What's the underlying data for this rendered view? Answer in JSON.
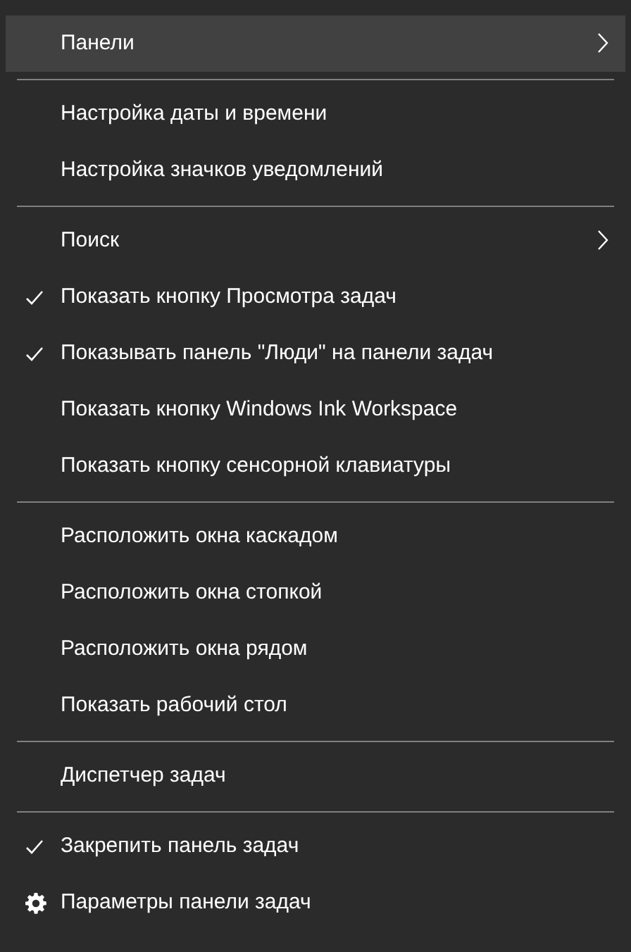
{
  "menu": {
    "items": [
      {
        "kind": "item",
        "label": "Панели",
        "checked": false,
        "submenu": true,
        "selected": true
      },
      {
        "kind": "separator"
      },
      {
        "kind": "item",
        "label": "Настройка даты и времени",
        "checked": false,
        "submenu": false,
        "selected": false
      },
      {
        "kind": "item",
        "label": "Настройка значков уведомлений",
        "checked": false,
        "submenu": false,
        "selected": false
      },
      {
        "kind": "separator"
      },
      {
        "kind": "item",
        "label": "Поиск",
        "checked": false,
        "submenu": true,
        "selected": false
      },
      {
        "kind": "item",
        "label": "Показать кнопку Просмотра задач",
        "checked": true,
        "submenu": false,
        "selected": false
      },
      {
        "kind": "item",
        "label": "Показывать панель \"Люди\" на панели задач",
        "checked": true,
        "submenu": false,
        "selected": false
      },
      {
        "kind": "item",
        "label": "Показать кнопку Windows Ink Workspace",
        "checked": false,
        "submenu": false,
        "selected": false
      },
      {
        "kind": "item",
        "label": "Показать кнопку сенсорной клавиатуры",
        "checked": false,
        "submenu": false,
        "selected": false
      },
      {
        "kind": "separator"
      },
      {
        "kind": "item",
        "label": "Расположить окна каскадом",
        "checked": false,
        "submenu": false,
        "selected": false
      },
      {
        "kind": "item",
        "label": "Расположить окна стопкой",
        "checked": false,
        "submenu": false,
        "selected": false
      },
      {
        "kind": "item",
        "label": "Расположить окна рядом",
        "checked": false,
        "submenu": false,
        "selected": false
      },
      {
        "kind": "item",
        "label": "Показать рабочий стол",
        "checked": false,
        "submenu": false,
        "selected": false
      },
      {
        "kind": "separator"
      },
      {
        "kind": "item",
        "label": "Диспетчер задач",
        "checked": false,
        "submenu": false,
        "selected": false
      },
      {
        "kind": "separator"
      },
      {
        "kind": "item",
        "label": "Закрепить панель задач",
        "checked": true,
        "submenu": false,
        "selected": false
      },
      {
        "kind": "settings",
        "label": "Параметры панели задач",
        "selected": false
      }
    ]
  }
}
